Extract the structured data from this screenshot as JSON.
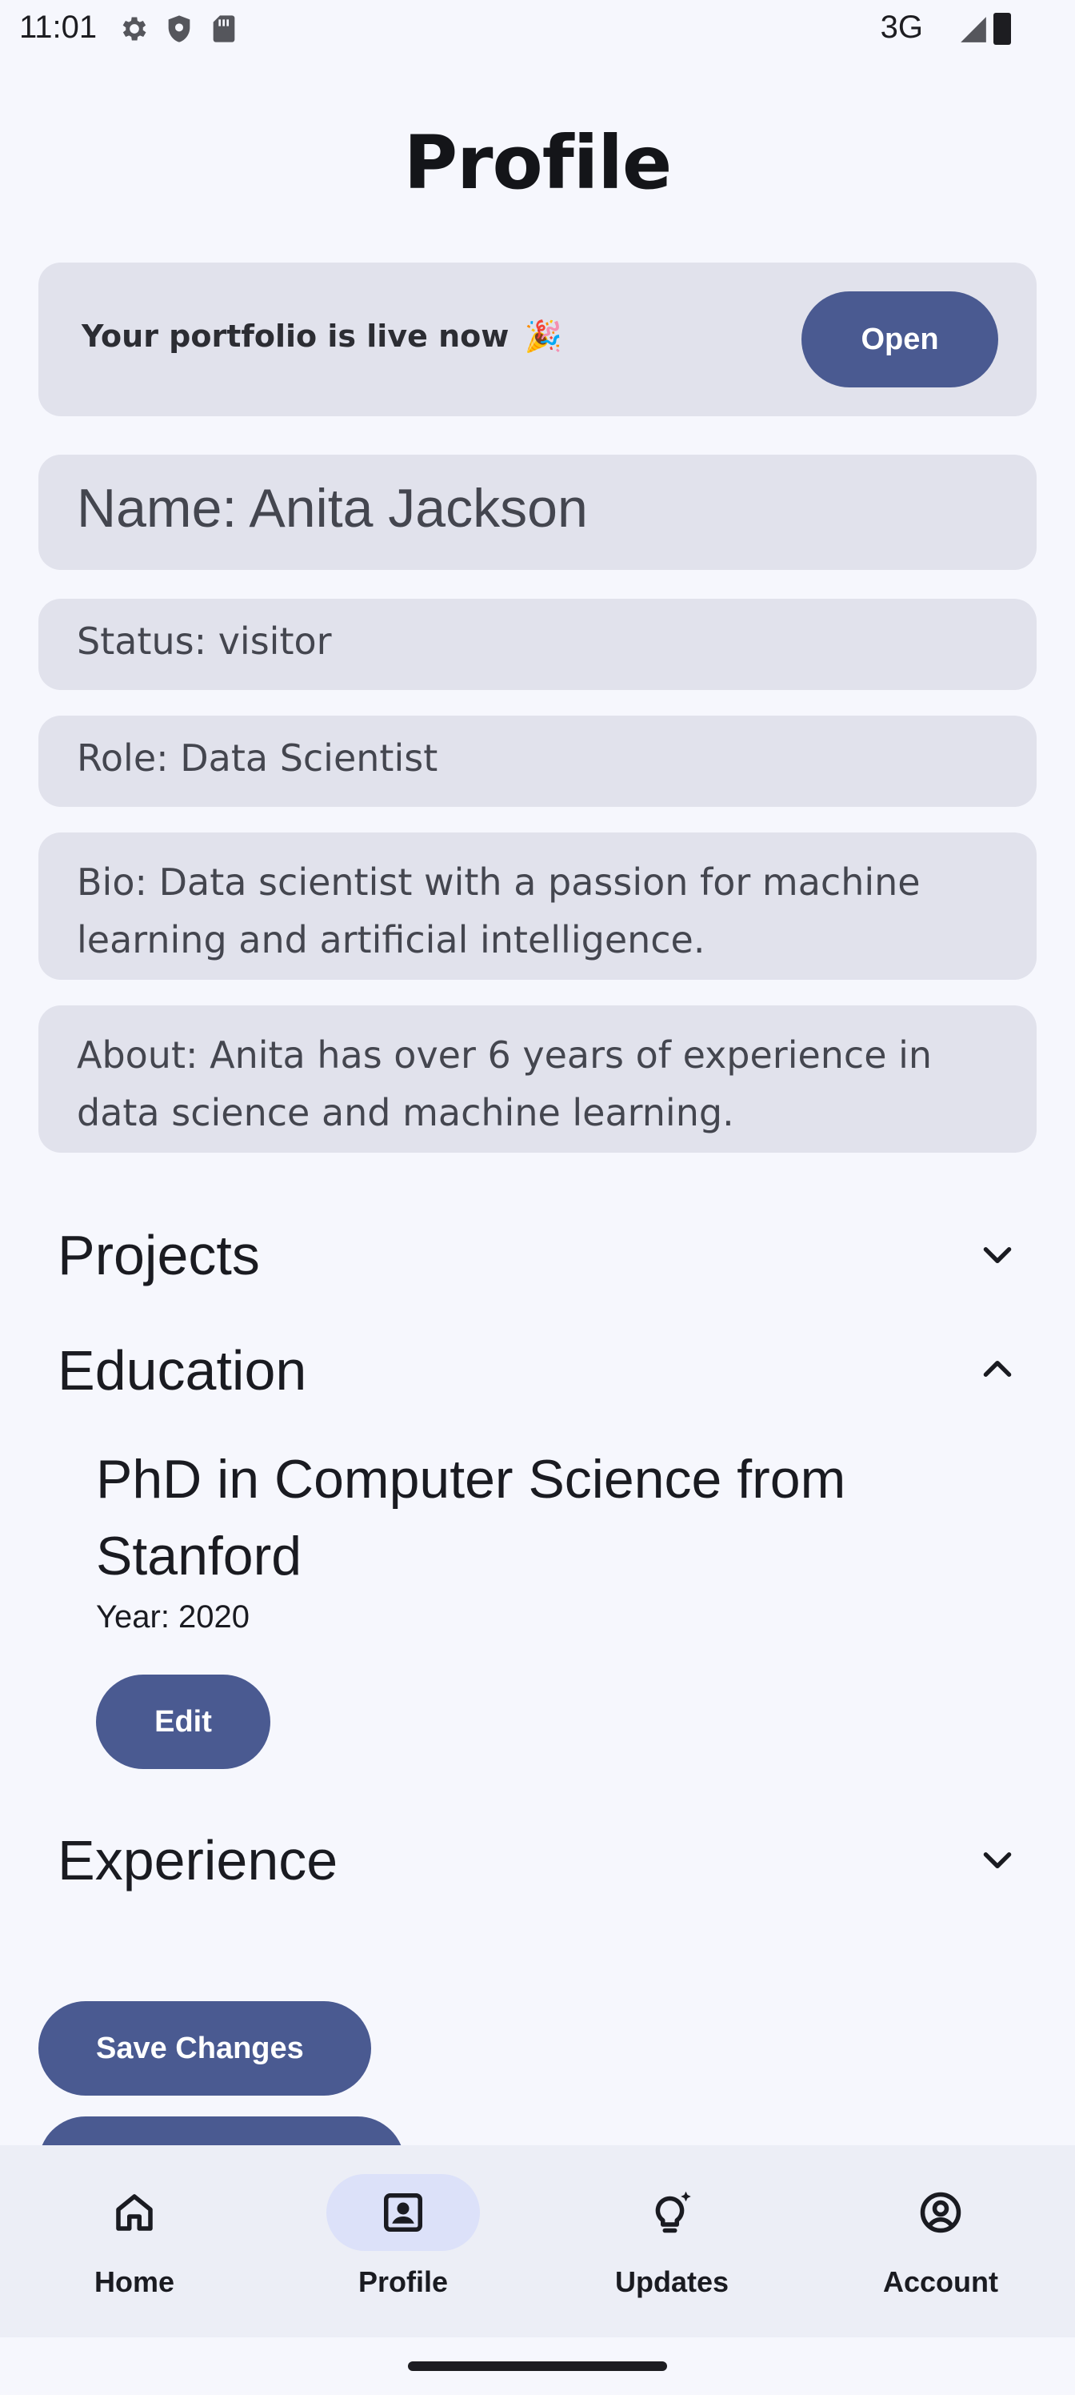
{
  "status_bar": {
    "time": "11:01",
    "network": "3G",
    "icons": [
      "gear-icon",
      "shield-icon",
      "sim-card-icon",
      "signal-icon",
      "battery-icon"
    ]
  },
  "page": {
    "title": "Profile"
  },
  "banner": {
    "text": "Your portfolio is live now",
    "emoji": "🎉",
    "button_label": "Open"
  },
  "profile": {
    "name": "Name: Anita Jackson",
    "status": "Status: visitor",
    "role": "Role: Data Scientist",
    "bio": "Bio: Data scientist with a passion for machine learning and artificial intelligence.",
    "about": "About: Anita has over 6 years of experience in data science and machine learning."
  },
  "sections": {
    "projects": {
      "title": "Projects",
      "expanded": false
    },
    "education": {
      "title": "Education",
      "expanded": true,
      "items": [
        {
          "degree": "PhD in Computer Science from Stanford",
          "year": "Year: 2020",
          "edit_label": "Edit"
        }
      ]
    },
    "experience": {
      "title": "Experience",
      "expanded": false
    }
  },
  "actions": {
    "save_label": "Save Changes"
  },
  "bottom_nav": {
    "items": [
      {
        "label": "Home",
        "icon": "home-icon",
        "active": false
      },
      {
        "label": "Profile",
        "icon": "profile-icon",
        "active": true
      },
      {
        "label": "Updates",
        "icon": "lightbulb-icon",
        "active": false
      },
      {
        "label": "Account",
        "icon": "account-circle-icon",
        "active": false
      }
    ]
  },
  "colors": {
    "background": "#f6f7fd",
    "card": "#e1e2ec",
    "primary": "#4a5a91",
    "nav_active": "#dce1f9",
    "nav_bar": "#eceef6"
  }
}
